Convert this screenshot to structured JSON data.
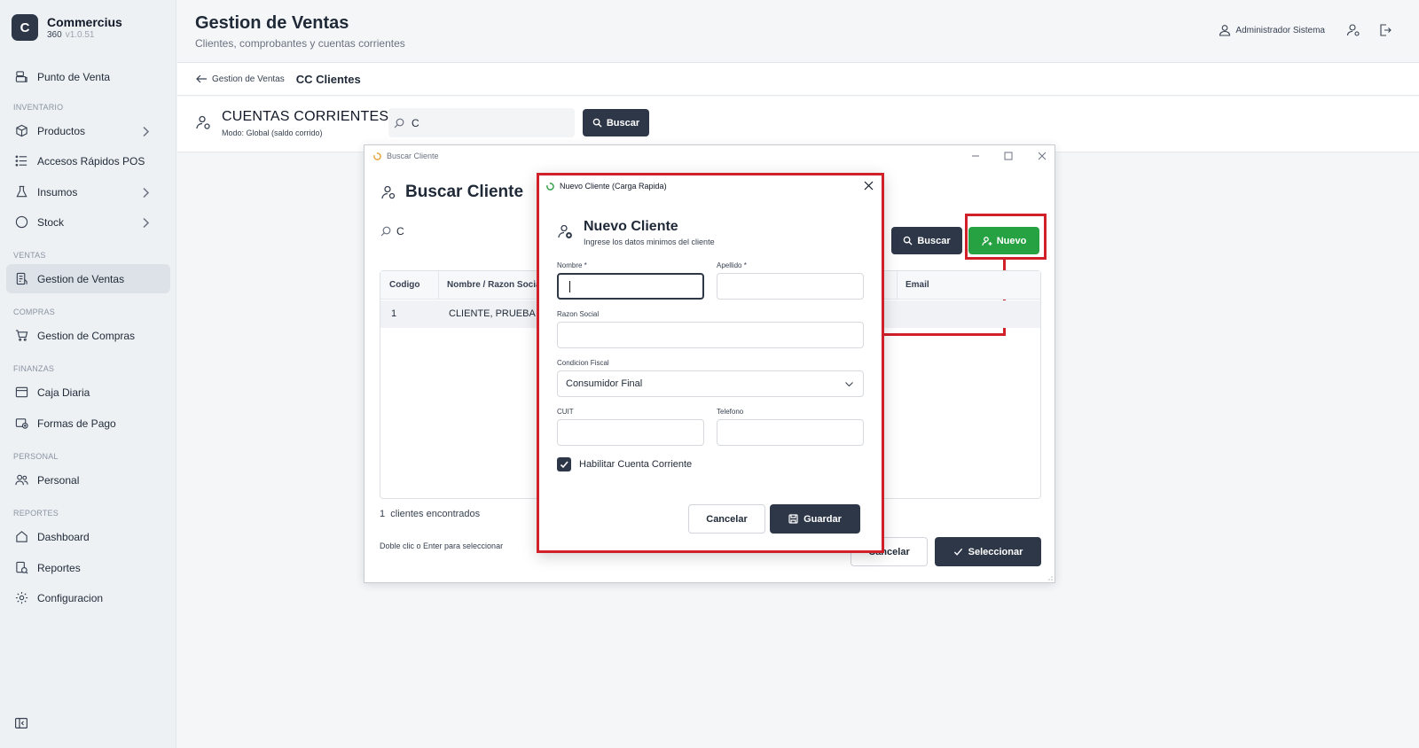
{
  "brand": {
    "logo_letter": "C",
    "name": "Commercius",
    "sub": "360",
    "version": "v1.0.51"
  },
  "sidebar": {
    "items": [
      {
        "label": "Punto de Venta"
      },
      {
        "label": "Productos"
      },
      {
        "label": "Accesos Rápidos POS"
      },
      {
        "label": "Insumos"
      },
      {
        "label": "Stock"
      },
      {
        "label": "Gestion de Ventas"
      },
      {
        "label": "Gestion de Compras"
      },
      {
        "label": "Caja Diaria"
      },
      {
        "label": "Formas de Pago"
      },
      {
        "label": "Personal"
      },
      {
        "label": "Dashboard"
      },
      {
        "label": "Reportes"
      },
      {
        "label": "Configuracion"
      }
    ],
    "sections": [
      "INVENTARIO",
      "VENTAS",
      "COMPRAS",
      "FINANZAS",
      "PERSONAL",
      "REPORTES"
    ],
    "active": "Gestion de Ventas"
  },
  "header": {
    "title": "Gestion de Ventas",
    "subtitle": "Clientes, comprobantes y cuentas corrientes",
    "user": "Administrador Sistema"
  },
  "breadcrumb": {
    "back": "Gestion de Ventas",
    "current": "CC Clientes"
  },
  "cc": {
    "title": "CUENTAS CORRIENTES",
    "mode": "Modo: Global (saldo corrido)",
    "search_value": "C",
    "search_button": "Buscar"
  },
  "buscar_cliente": {
    "window_title": "Buscar Cliente",
    "heading": "Buscar Cliente",
    "search_value": "C",
    "buscar_button": "Buscar",
    "nuevo_button": "Nuevo",
    "columns": [
      "Codigo",
      "Nombre / Razon Social",
      "Email"
    ],
    "rows": [
      {
        "codigo": "1",
        "nombre": "CLIENTE, PRUEBA",
        "email": ""
      }
    ],
    "found_count": "1",
    "found_label": "clientes encontrados",
    "hint": "Doble clic o Enter para seleccionar",
    "cancel_button": "Cancelar",
    "select_button": "Seleccionar"
  },
  "nuevo_cliente": {
    "window_title": "Nuevo Cliente (Carga Rapida)",
    "heading": "Nuevo Cliente",
    "subheading": "Ingrese los datos minimos del cliente",
    "fields": {
      "nombre_label": "Nombre *",
      "nombre_value": "",
      "apellido_label": "Apellido *",
      "apellido_value": "",
      "razon_social_label": "Razon Social",
      "razon_social_value": "",
      "condicion_fiscal_label": "Condicion Fiscal",
      "condicion_fiscal_value": "Consumidor Final",
      "cuit_label": "CUIT",
      "cuit_value": "",
      "telefono_label": "Telefono",
      "telefono_value": ""
    },
    "habilitar_cc_label": "Habilitar Cuenta Corriente",
    "habilitar_cc_checked": true,
    "cancel_button": "Cancelar",
    "save_button": "Guardar"
  },
  "colors": {
    "primary_dark": "#2d3748",
    "success": "#27a243",
    "highlight_red": "#d0202a",
    "sidebar_bg": "#eef1f4"
  },
  "icons": {
    "punto_de_venta": "register-icon",
    "productos": "box-icon",
    "accesos": "list-icon",
    "insumos": "flask-icon",
    "stock": "circle-icon",
    "gestion_ventas": "receipt-icon",
    "gestion_compras": "cart-icon",
    "caja": "calendar-icon",
    "formas_pago": "card-icon",
    "personal": "users-icon",
    "dashboard": "home-icon",
    "reportes": "report-icon",
    "configuracion": "gear-icon"
  }
}
